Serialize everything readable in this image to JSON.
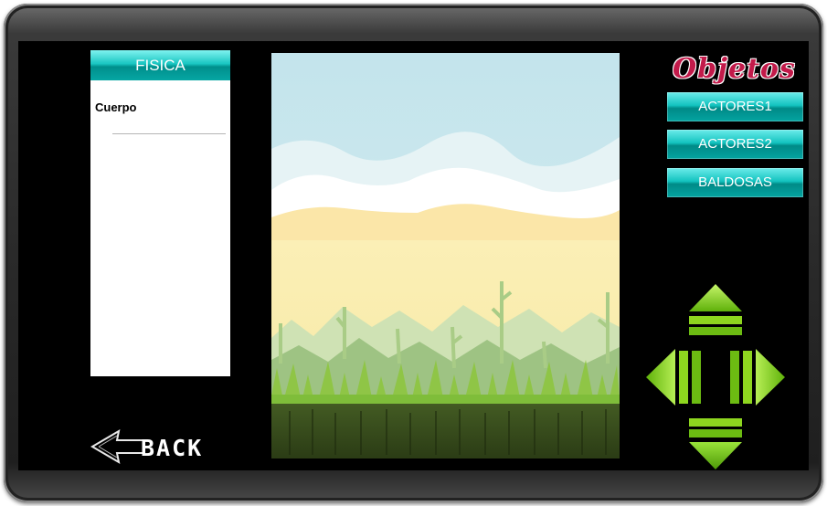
{
  "physics_panel": {
    "header": "FISICA",
    "items": [
      "Cuerpo"
    ]
  },
  "objects_panel": {
    "title": "Objetos",
    "buttons": [
      "ACTORES1",
      "ACTORES2",
      "BALDOSAS"
    ]
  },
  "back_button": {
    "label": "BACK"
  },
  "controls": {
    "dpad": [
      "up",
      "down",
      "left",
      "right"
    ]
  },
  "colors": {
    "button_teal": "#13c3bf",
    "title_red": "#c21a4a",
    "dpad_green": "#7fd80a",
    "sky": "#cde9ef",
    "grass": "#7fbd3a"
  }
}
